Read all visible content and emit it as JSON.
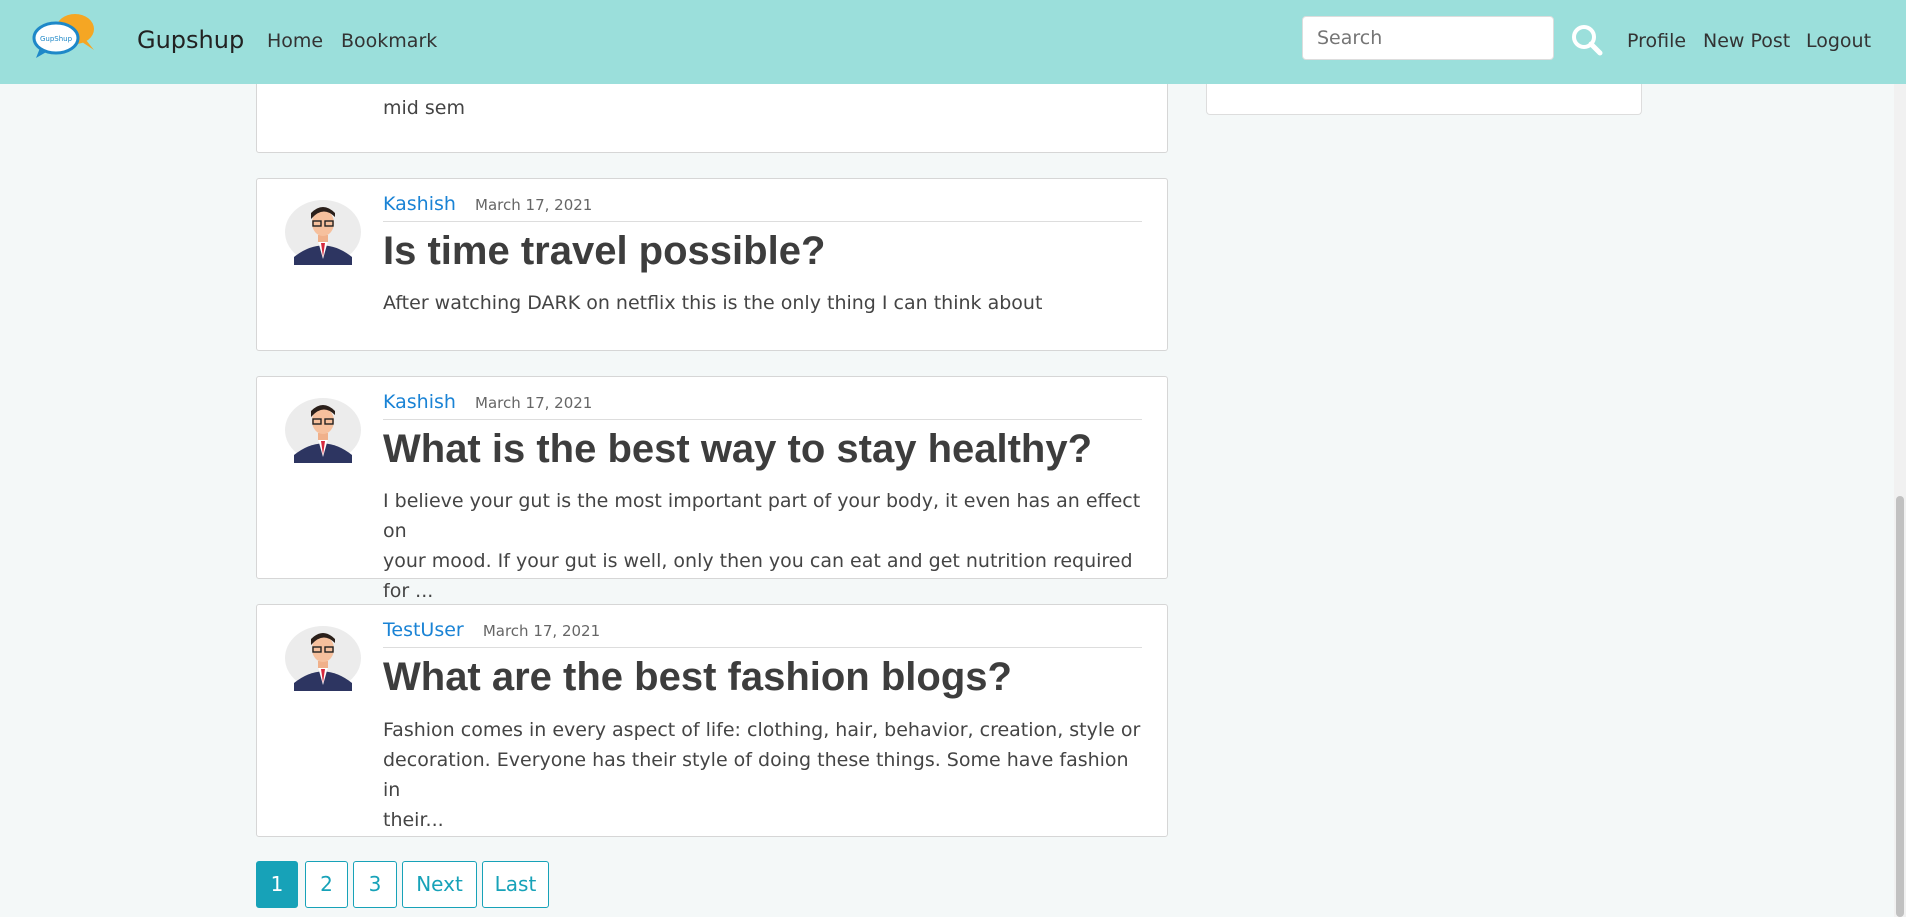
{
  "navbar": {
    "brand": "Gupshup",
    "logo_text": "GupShup",
    "links_left": [
      "Home",
      "Bookmark"
    ],
    "search_placeholder": "Search",
    "links_right": [
      "Profile",
      "New Post",
      "Logout"
    ]
  },
  "posts": [
    {
      "excerpt": "mid sem"
    },
    {
      "author": "Kashish",
      "date": "March 17, 2021",
      "title": "Is time travel possible?",
      "excerpt": "After watching DARK on netflix this is the only thing I can think about"
    },
    {
      "author": "Kashish",
      "date": "March 17, 2021",
      "title": "What is the best way to stay healthy?",
      "excerpt_lines": [
        "I believe your gut is the most important part of your body, it even has an effect on",
        "your mood. If your gut is well, only then you can eat and get nutrition required for ..."
      ]
    },
    {
      "author": "TestUser",
      "date": "March 17, 2021",
      "title": "What are the best fashion blogs?",
      "excerpt_lines": [
        "Fashion comes in every aspect of life: clothing, hair, behavior, creation, style or",
        "decoration. Everyone has their style of doing these things. Some have fashion in",
        "their..."
      ]
    }
  ],
  "pagination": [
    "1",
    "2",
    "3",
    "Next",
    "Last"
  ],
  "colors": {
    "navbar": "#9bdfdb",
    "link": "#1a83d5",
    "accent": "#17a2b8"
  }
}
